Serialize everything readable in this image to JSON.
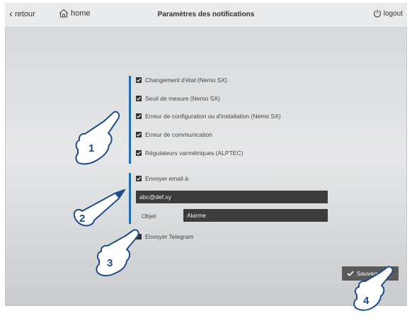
{
  "topbar": {
    "back_label": "retour",
    "home_label": "home",
    "title": "Paramètres des notifications",
    "logout_label": "logout"
  },
  "alerts": [
    {
      "label": "Changement d'état (Nemo SX)",
      "checked": true
    },
    {
      "label": "Seuil de mesure (Nemo SX)",
      "checked": true
    },
    {
      "label": "Erreur de configuration ou d'installation (Nemo SX)",
      "checked": true
    },
    {
      "label": "Erreur de communication",
      "checked": true
    },
    {
      "label": "Régulateurs varmétriques (ALPTEC)",
      "checked": true
    }
  ],
  "email": {
    "send_label": "Envoyer email à",
    "checked": true,
    "address_value": "abc@def.xy",
    "subject_label": "Objet",
    "subject_value": "Alarme"
  },
  "telegram": {
    "send_label": "Envoyer Telegram",
    "checked": false
  },
  "save_button_label": "Sauvegarder",
  "callouts": [
    "1",
    "2",
    "3",
    "4"
  ],
  "colors": {
    "accent_bar": "#1f6fb8",
    "field_bg": "#3c3c3c",
    "button_bg": "#5a5a5a",
    "callout_number": "#1f4d8c"
  }
}
